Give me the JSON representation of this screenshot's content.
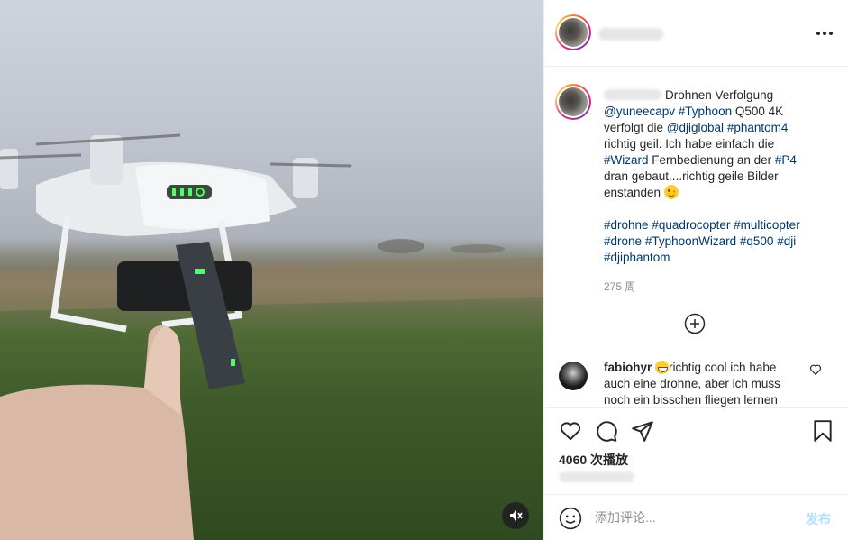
{
  "post": {
    "caption": {
      "line1_suffix": "Drohnen Verfolgung",
      "mention1": "@yuneecapv",
      "tag_typhoon": "#Typhoon",
      "model": " Q500 4K",
      "verfolgt": "verfolgt die ",
      "mention2": "@djiglobal",
      "tag_phantom4": "#phantom4",
      "text_geil": "richtig geil. Ich habe einfach die",
      "tag_wizard": "#Wizard",
      "text_fernbedienung": " Fernbedienung an der ",
      "tag_p4": "#P4",
      "text_gebaut": "dran gebaut....richtig geile Bilder",
      "text_entstanden": "enstanden ",
      "hashtags": [
        "#drohne",
        "#quadrocopter",
        "#multicopter",
        "#drone",
        "#TyphoonWizard",
        "#q500",
        "#dji",
        "#djiphantom"
      ]
    },
    "time_ago": "275 周",
    "comment": {
      "user": "fabiohyr",
      "text": "richtig cool ich habe auch eine drohne, aber ich muss noch ein bisschen fliegen lernen"
    },
    "views": "4060 次播放"
  },
  "comment_bar": {
    "placeholder": "添加评论...",
    "post_label": "发布"
  },
  "colors": {
    "link": "#00376b",
    "post_button_disabled": "#b2dffc",
    "border": "#efefef"
  },
  "icons": [
    "more-icon",
    "add-circle-icon",
    "heart-icon",
    "comment-icon",
    "share-icon",
    "bookmark-icon",
    "emoji-icon",
    "mute-icon"
  ]
}
